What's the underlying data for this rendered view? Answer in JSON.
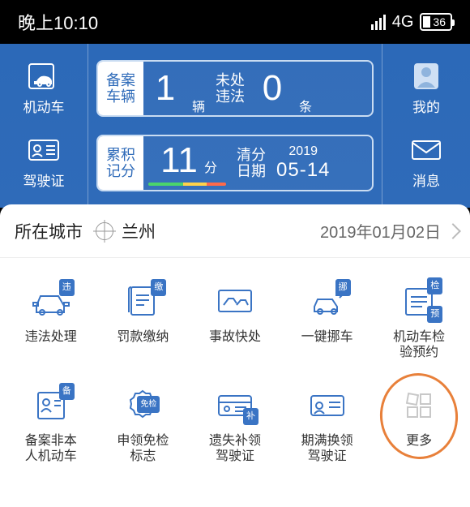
{
  "statusbar": {
    "time": "晚上10:10",
    "network": "4G",
    "battery": "36"
  },
  "header": {
    "left": {
      "vehicle": "机动车",
      "license": "驾驶证"
    },
    "right": {
      "mine": "我的",
      "messages": "消息"
    },
    "card1": {
      "label": "备案\n车辆",
      "value": "1",
      "unit": "辆",
      "label2": "未处\n违法",
      "value2": "0",
      "unit2": "条"
    },
    "card2": {
      "label": "累积\n记分",
      "value": "11",
      "unit": "分",
      "label2": "清分\n日期",
      "year": "2019",
      "monthday": "05-14"
    }
  },
  "cityrow": {
    "label": "所在城市",
    "city": "兰州",
    "date": "2019年01月02日"
  },
  "grid": {
    "items": [
      {
        "label": "违法处理",
        "badge": "违"
      },
      {
        "label": "罚款缴纳",
        "badge": "缴"
      },
      {
        "label": "事故快处",
        "badge": ""
      },
      {
        "label": "一键挪车",
        "badge": "挪"
      },
      {
        "label": "机动车检\n验预约",
        "badge": "检",
        "badge2": "预"
      },
      {
        "label": "备案非本\n人机动车",
        "badge": "备"
      },
      {
        "label": "申领免检\n标志",
        "badge": "免检"
      },
      {
        "label": "遗失补领\n驾驶证",
        "badge": "补"
      },
      {
        "label": "期满换领\n驾驶证",
        "badge": ""
      },
      {
        "label": "更多",
        "badge": ""
      }
    ]
  }
}
